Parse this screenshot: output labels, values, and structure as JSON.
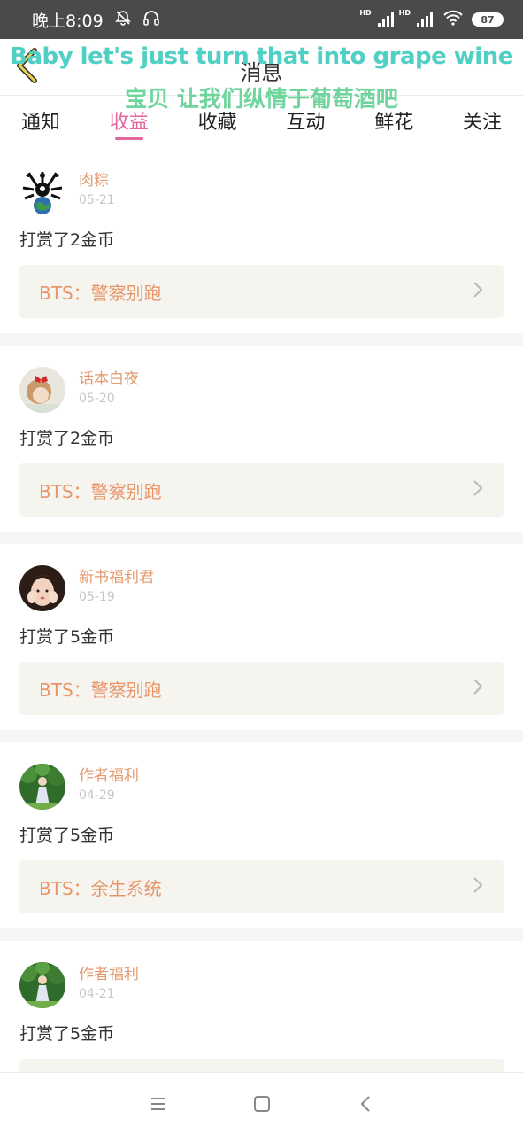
{
  "status_bar": {
    "time": "晚上8:09",
    "hd1": "HD",
    "hd2": "HD",
    "battery": "87",
    "icons": [
      "alarm-off-icon",
      "headset-icon",
      "signal-icon",
      "wifi-icon",
      "battery-icon"
    ]
  },
  "nav": {
    "title": "消息",
    "back_icon": "back-arrow-icon"
  },
  "lyrics": {
    "en": "Baby let's just turn that into grape wine",
    "zh": "宝贝 让我们纵情于葡萄酒吧"
  },
  "tabs": [
    {
      "label": "通知"
    },
    {
      "label": "收益",
      "active": true
    },
    {
      "label": "收藏"
    },
    {
      "label": "互动"
    },
    {
      "label": "鲜花"
    },
    {
      "label": "关注"
    }
  ],
  "items": [
    {
      "username": "肉粽",
      "date": "05-21",
      "action": "打赏了2金币",
      "book": "BTS：警察别跑",
      "avatar": "earth-logo-avatar"
    },
    {
      "username": "话本白夜",
      "date": "05-20",
      "action": "打赏了2金币",
      "book": "BTS：警察别跑",
      "avatar": "girl-red-bow-avatar"
    },
    {
      "username": "新书福利君",
      "date": "05-19",
      "action": "打赏了5金币",
      "book": "BTS：警察别跑",
      "avatar": "girl-face-avatar"
    },
    {
      "username": "作者福利",
      "date": "04-29",
      "action": "打赏了5金币",
      "book": "BTS：余生系统",
      "avatar": "forest-girl-avatar"
    },
    {
      "username": "作者福利",
      "date": "04-21",
      "action": "打赏了5金币",
      "book": "",
      "avatar": "forest-girl-avatar"
    }
  ],
  "colors": {
    "accent": "#e466a0",
    "username": "#e39a6e",
    "book_title": "#e8956a",
    "status_bar": "#4a4a4a"
  },
  "bottom_nav": [
    "menu-icon",
    "home-square-icon",
    "back-chevron-icon"
  ]
}
